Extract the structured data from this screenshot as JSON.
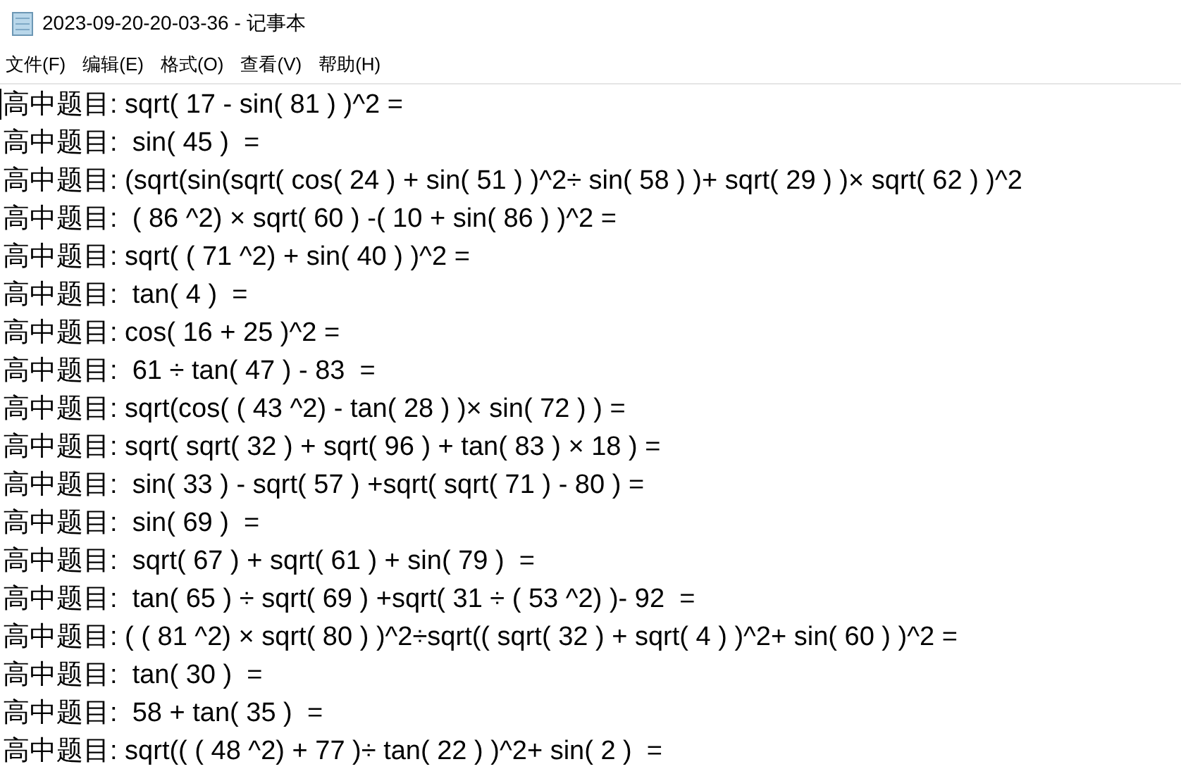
{
  "window": {
    "title": "2023-09-20-20-03-36 - 记事本"
  },
  "menu": [
    "文件(F)",
    "编辑(E)",
    "格式(O)",
    "查看(V)",
    "帮助(H)"
  ],
  "editor": {
    "lines": [
      "高中题目: sqrt( 17 - sin( 81 ) )^2 =",
      "高中题目:  sin( 45 )  =",
      "高中题目: (sqrt(sin(sqrt( cos( 24 ) + sin( 51 ) )^2÷ sin( 58 ) )+ sqrt( 29 ) )× sqrt( 62 ) )^2",
      "高中题目:  ( 86 ^2) × sqrt( 60 ) -( 10 + sin( 86 ) )^2 =",
      "高中题目: sqrt( ( 71 ^2) + sin( 40 ) )^2 =",
      "高中题目:  tan( 4 )  =",
      "高中题目: cos( 16 + 25 )^2 =",
      "高中题目:  61 ÷ tan( 47 ) - 83  =",
      "高中题目: sqrt(cos( ( 43 ^2) - tan( 28 ) )× sin( 72 ) ) =",
      "高中题目: sqrt( sqrt( 32 ) + sqrt( 96 ) + tan( 83 ) × 18 ) =",
      "高中题目:  sin( 33 ) - sqrt( 57 ) +sqrt( sqrt( 71 ) - 80 ) =",
      "高中题目:  sin( 69 )  =",
      "高中题目:  sqrt( 67 ) + sqrt( 61 ) + sin( 79 )  =",
      "高中题目:  tan( 65 ) ÷ sqrt( 69 ) +sqrt( 31 ÷ ( 53 ^2) )- 92  =",
      "高中题目: ( ( 81 ^2) × sqrt( 80 ) )^2÷sqrt(( sqrt( 32 ) + sqrt( 4 ) )^2+ sin( 60 ) )^2 =",
      "高中题目:  tan( 30 )  =",
      "高中题目:  58 + tan( 35 )  =",
      "高中题目: sqrt(( ( 48 ^2) + 77 )÷ tan( 22 ) )^2+ sin( 2 )  ="
    ]
  }
}
